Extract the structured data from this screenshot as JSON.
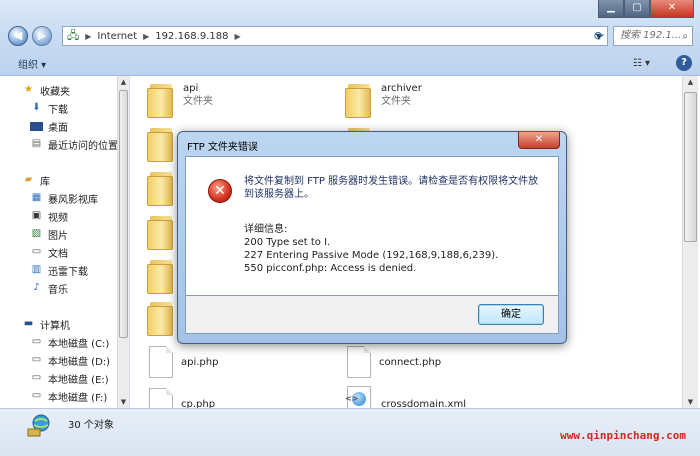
{
  "window": {
    "controls": {
      "minimize": "▁",
      "maximize": "▢",
      "close": "✕"
    }
  },
  "address": {
    "crumbs": [
      "Internet",
      "192.168.9.188"
    ],
    "search_placeholder": "搜索 192.1..."
  },
  "toolbar": {
    "organize": "组织 ▾",
    "views": "☷ ▾",
    "help": "?"
  },
  "nav": {
    "favorites_header": "收藏夹",
    "favorites": [
      "下载",
      "桌面",
      "最近访问的位置"
    ],
    "libraries_header": "库",
    "libraries": [
      "暴风影视库",
      "视频",
      "图片",
      "文档",
      "迅雷下载",
      "音乐"
    ],
    "computer_header": "计算机",
    "drives": [
      "本地磁盘 (C:)",
      "本地磁盘 (D:)",
      "本地磁盘 (E:)",
      "本地磁盘 (F:)"
    ]
  },
  "files": {
    "folder_type": "文件夹",
    "folders": [
      "api",
      "archiver"
    ],
    "php_files": [
      "api.php",
      "connect.php",
      "cp.php"
    ],
    "xml_file": "crossdomain.xml"
  },
  "status": {
    "count": "30 个对象",
    "watermark": "www.qinpinchang.com"
  },
  "dialog": {
    "title": "FTP 文件夹错误",
    "close": "✕",
    "message": "将文件复制到 FTP 服务器时发生错误。请检查是否有权限将文件放到该服务器上。",
    "details_label": "详细信息:",
    "details": [
      "200 Type set to I.",
      "227 Entering Passive Mode (192,168,9,188,6,239).",
      "550 picconf.php: Access is denied."
    ],
    "ok": "确定"
  },
  "colors": {
    "accent": "#3c7fb1",
    "error": "#d53220",
    "watermark": "#d2291e"
  }
}
